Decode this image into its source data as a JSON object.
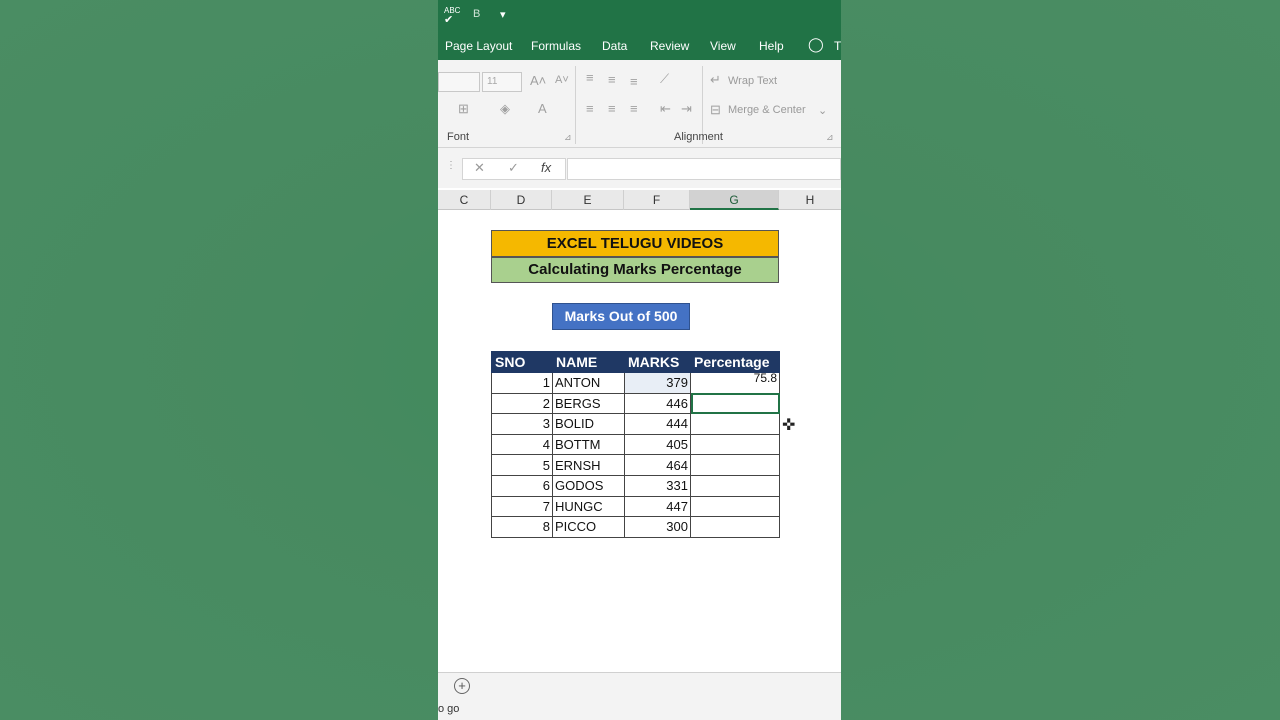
{
  "quick_access": {
    "spell": "ABC",
    "bold": "B",
    "more": "▾"
  },
  "tabs": [
    {
      "label": "Page Layout"
    },
    {
      "label": "Formulas"
    },
    {
      "label": "Data"
    },
    {
      "label": "Review"
    },
    {
      "label": "View"
    },
    {
      "label": "Help"
    },
    {
      "label": "T"
    }
  ],
  "ribbon": {
    "font_size": "11",
    "wrap_text": "Wrap Text",
    "merge_center": "Merge & Center",
    "font_group": "Font",
    "alignment_group": "Alignment"
  },
  "formula_bar": {
    "cancel": "✕",
    "enter": "✓",
    "fx": "fx",
    "value": ""
  },
  "columns": [
    "C",
    "D",
    "E",
    "F",
    "G",
    "H"
  ],
  "sheet": {
    "banner_title": "EXCEL TELUGU VIDEOS",
    "banner_subtitle": "Calculating Marks Percentage",
    "marks_out_of": "Marks Out of 500",
    "headers": [
      "SNO",
      "NAME",
      "MARKS",
      "Percentage"
    ],
    "rows": [
      {
        "sno": "1",
        "name": "ANTON",
        "marks": "379",
        "pct": "75.8"
      },
      {
        "sno": "2",
        "name": "BERGS",
        "marks": "446",
        "pct": ""
      },
      {
        "sno": "3",
        "name": "BOLID",
        "marks": "444",
        "pct": ""
      },
      {
        "sno": "4",
        "name": "BOTTM",
        "marks": "405",
        "pct": ""
      },
      {
        "sno": "5",
        "name": "ERNSH",
        "marks": "464",
        "pct": ""
      },
      {
        "sno": "6",
        "name": "GODOS",
        "marks": "331",
        "pct": ""
      },
      {
        "sno": "7",
        "name": "HUNGC",
        "marks": "447",
        "pct": ""
      },
      {
        "sno": "8",
        "name": "PICCO",
        "marks": "300",
        "pct": ""
      }
    ]
  },
  "status": {
    "text": "o go"
  },
  "colors": {
    "excel_green": "#217346",
    "banner_yellow": "#f5b800",
    "banner_green": "#a9d08e",
    "header_navy": "#1f3864",
    "marks_blue": "#4472c4"
  }
}
